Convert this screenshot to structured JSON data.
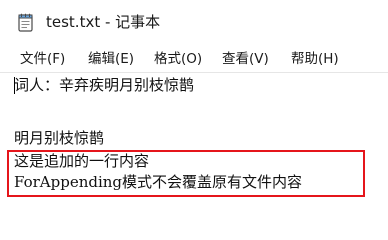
{
  "window": {
    "title": "test.txt - 记事本",
    "app_icon": "notepad-icon"
  },
  "menu": {
    "items": [
      {
        "label": "文件(F)"
      },
      {
        "label": "编辑(E)"
      },
      {
        "label": "格式(O)"
      },
      {
        "label": "查看(V)"
      },
      {
        "label": "帮助(H)"
      }
    ]
  },
  "document": {
    "lines": [
      "词人：辛弃疾明月别枝惊鹊",
      "",
      "明月别枝惊鹊",
      "这是追加的一行内容",
      "ForAppending模式不会覆盖原有文件内容"
    ]
  },
  "annotation": {
    "highlight_color": "#e5151b"
  }
}
